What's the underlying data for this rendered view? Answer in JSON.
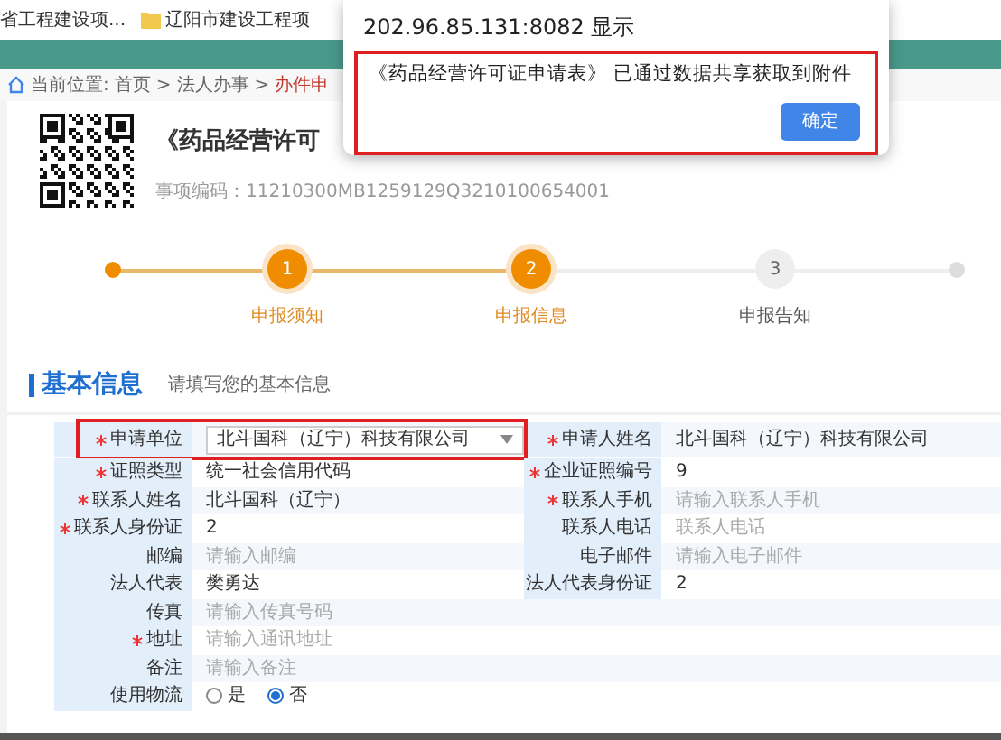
{
  "bookmarks": [
    {
      "label": "省工程建设项...",
      "folder": false
    },
    {
      "label": "辽阳市建设工程项",
      "folder": true
    }
  ],
  "breadcrumb": {
    "prefix": "当前位置:",
    "separator": ">",
    "items": [
      {
        "label": "首页",
        "current": false
      },
      {
        "label": "法人办事",
        "current": false
      },
      {
        "label": "办件申",
        "current": true
      }
    ]
  },
  "service": {
    "title": "《药品经营许可",
    "code": "事项编码：11210300MB1259129Q3210100654001"
  },
  "steps": [
    {
      "number": "1",
      "label": "申报须知",
      "done": true
    },
    {
      "number": "2",
      "label": "申报信息",
      "done": true
    },
    {
      "number": "3",
      "label": "申报告知",
      "done": false
    }
  ],
  "section": {
    "title": "基本信息",
    "hint": "请填写您的基本信息"
  },
  "form_rows": [
    [
      {
        "label": "申请单位",
        "required": true,
        "value": "北斗国科（辽宁）科技有限公司",
        "kind": "select",
        "highlighted": true
      },
      {
        "label": "申请人姓名",
        "required": true,
        "value": "北斗国科（辽宁）科技有限公司",
        "kind": "text"
      }
    ],
    [
      {
        "label": "证照类型",
        "required": true,
        "value": "统一社会信用代码",
        "kind": "text"
      },
      {
        "label": "企业证照编号",
        "required": true,
        "value": "9",
        "kind": "text"
      }
    ],
    [
      {
        "label": "联系人姓名",
        "required": true,
        "value": "北斗国科（辽宁）",
        "kind": "text"
      },
      {
        "label": "联系人手机",
        "required": true,
        "placeholder": "请输入联系人手机",
        "kind": "text"
      }
    ],
    [
      {
        "label": "联系人身份证",
        "required": true,
        "value": "2",
        "kind": "text"
      },
      {
        "label": "联系人电话",
        "required": false,
        "placeholder": "联系人电话",
        "kind": "text"
      }
    ],
    [
      {
        "label": "邮编",
        "required": false,
        "placeholder": "请输入邮编",
        "kind": "text"
      },
      {
        "label": "电子邮件",
        "required": false,
        "placeholder": "请输入电子邮件",
        "kind": "text"
      }
    ],
    [
      {
        "label": "法人代表",
        "required": false,
        "value": "樊勇达",
        "kind": "text"
      },
      {
        "label": "法人代表身份证",
        "required": false,
        "value": "2",
        "kind": "text"
      }
    ],
    [
      {
        "label": "传真",
        "required": false,
        "placeholder": "请输入传真号码",
        "kind": "text"
      }
    ],
    [
      {
        "label": "地址",
        "required": true,
        "placeholder": "请输入通讯地址",
        "kind": "text"
      }
    ],
    [
      {
        "label": "备注",
        "required": false,
        "placeholder": "请输入备注",
        "kind": "text"
      }
    ],
    [
      {
        "label": "使用物流",
        "required": false,
        "kind": "radio",
        "options": [
          {
            "label": "是",
            "selected": false
          },
          {
            "label": "否",
            "selected": true
          }
        ]
      }
    ]
  ],
  "dialog": {
    "title": "202.96.85.131:8082 显示",
    "message": "《药品经营许可证申请表》 已通过数据共享获取到附件",
    "highlighted": true,
    "buttons": [
      "确定"
    ]
  }
}
